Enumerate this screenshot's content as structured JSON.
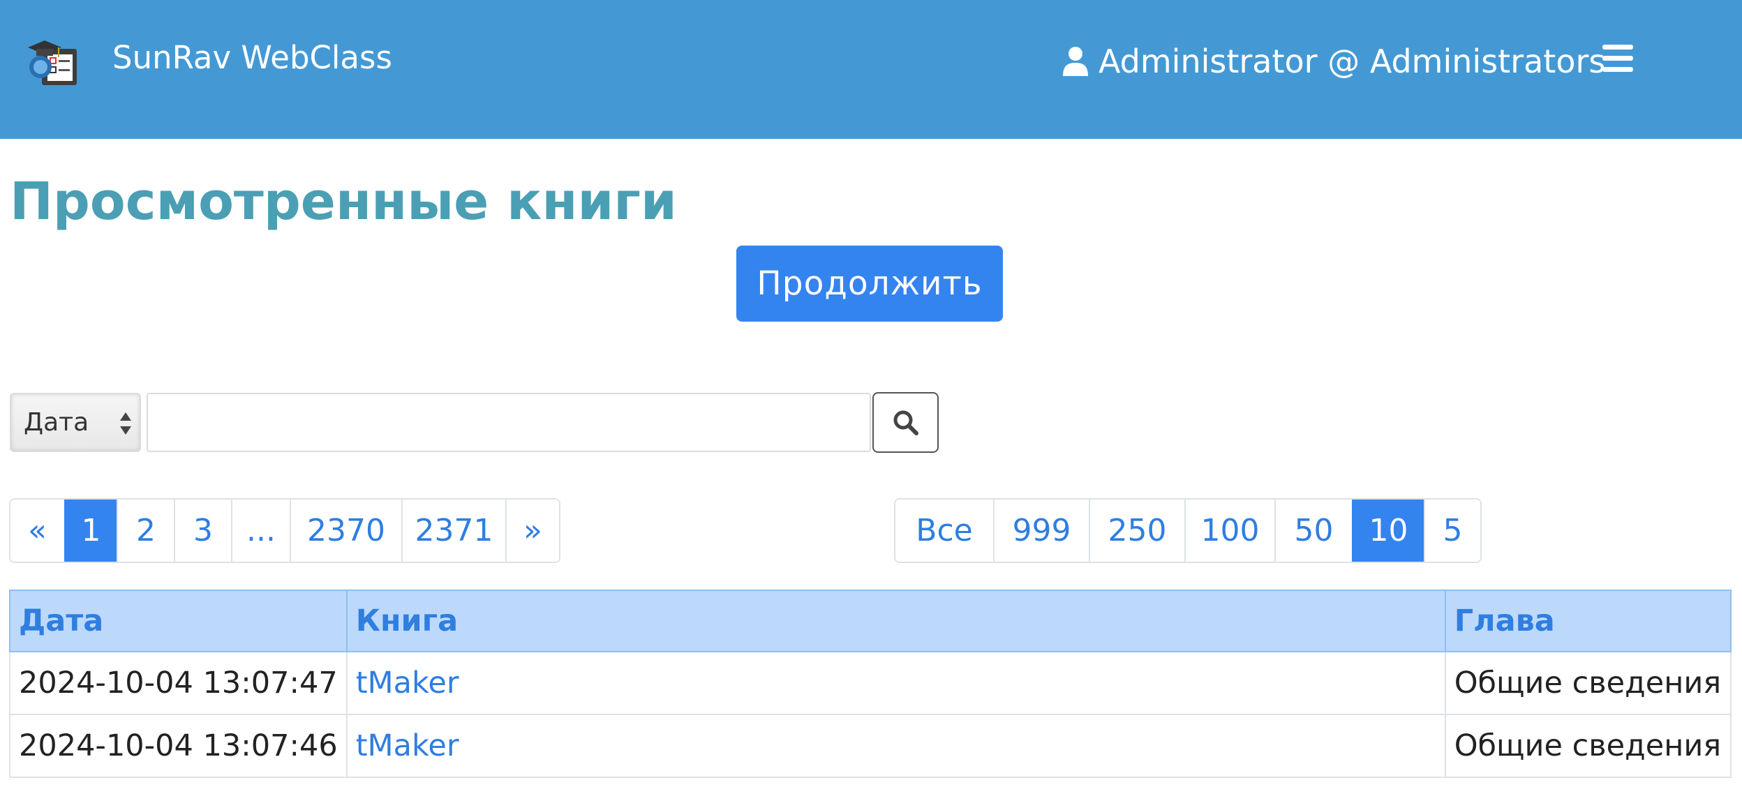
{
  "header": {
    "brand": "SunRav WebClass",
    "user": "Administrator @ Administrators",
    "icons": {
      "logo": "graduation-cap-monitor-logo",
      "user": "user-icon",
      "menu": "hamburger-menu-icon"
    },
    "bg_color": "#4499d4"
  },
  "page": {
    "title": "Просмотренные книги",
    "continue_label": "Продолжить"
  },
  "search": {
    "field_selected": "Дата",
    "query": "",
    "search_icon": "search-icon"
  },
  "pagination": {
    "pages": [
      "«",
      "1",
      "2",
      "3",
      "...",
      "2370",
      "2371",
      "»"
    ],
    "active": "1"
  },
  "page_size": {
    "options": [
      "Все",
      "999",
      "250",
      "100",
      "50",
      "10",
      "5"
    ],
    "active": "10"
  },
  "table": {
    "columns": [
      "Дата",
      "Книга",
      "Глава"
    ],
    "rows": [
      [
        "2024-10-04 13:07:47",
        "tMaker",
        "Общие сведения"
      ],
      [
        "2024-10-04 13:07:46",
        "tMaker",
        "Общие сведения"
      ]
    ]
  },
  "colors": {
    "accent": "#3484f0",
    "title": "#4b9fb5",
    "header_row": "#bcd9fb"
  }
}
